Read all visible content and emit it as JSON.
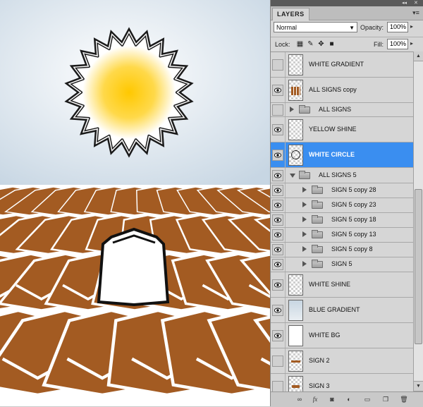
{
  "panel": {
    "tab_label": "LAYERS",
    "blend_mode": "Normal",
    "opacity_label": "Opacity:",
    "opacity_value": "100%",
    "lock_label": "Lock:",
    "fill_label": "Fill:",
    "fill_value": "100%"
  },
  "layers": [
    {
      "name": "WHITE GRADIENT",
      "visible": false,
      "kind": "layer",
      "thumb": "checker"
    },
    {
      "name": "ALL SIGNS copy",
      "visible": true,
      "kind": "layer",
      "thumb": "signs"
    },
    {
      "name": "ALL SIGNS",
      "visible": false,
      "kind": "group",
      "expanded": false
    },
    {
      "name": "YELLOW SHINE",
      "visible": true,
      "kind": "layer",
      "thumb": "checker"
    },
    {
      "name": "WHITE CIRCLE",
      "visible": true,
      "kind": "layer",
      "thumb": "circle",
      "selected": true
    },
    {
      "name": "ALL SIGNS 5",
      "visible": true,
      "kind": "group",
      "expanded": true
    },
    {
      "name": "SIGN 5 copy 28",
      "visible": true,
      "kind": "subgroup"
    },
    {
      "name": "SIGN 5 copy 23",
      "visible": true,
      "kind": "subgroup"
    },
    {
      "name": "SIGN 5 copy 18",
      "visible": true,
      "kind": "subgroup"
    },
    {
      "name": "SIGN 5 copy 13",
      "visible": true,
      "kind": "subgroup"
    },
    {
      "name": "SIGN 5 copy 8",
      "visible": true,
      "kind": "subgroup"
    },
    {
      "name": "SIGN 5",
      "visible": true,
      "kind": "subgroup"
    },
    {
      "name": "WHITE SHINE",
      "visible": true,
      "kind": "layer",
      "thumb": "checker"
    },
    {
      "name": "BLUE GRADIENT",
      "visible": true,
      "kind": "layer",
      "thumb": "blue"
    },
    {
      "name": "WHITE BG",
      "visible": true,
      "kind": "layer",
      "thumb": "white"
    },
    {
      "name": "SIGN 2",
      "visible": false,
      "kind": "layer",
      "thumb": "sign-h"
    },
    {
      "name": "SIGN 3",
      "visible": false,
      "kind": "layer",
      "thumb": "sign-v"
    }
  ],
  "icons": {
    "lock": [
      "lock-transparent-icon",
      "lock-brush-icon",
      "lock-move-icon",
      "lock-all-icon"
    ],
    "bottom": [
      "link-icon",
      "fx-icon",
      "mask-icon",
      "adjustment-icon",
      "new-group-icon",
      "new-layer-icon",
      "trash-icon"
    ]
  },
  "colors": {
    "selection": "#3a8ef0",
    "sky_top": "#c7d6e3",
    "sun_core": "#ffc800",
    "tile_brown": "#a35b22"
  }
}
